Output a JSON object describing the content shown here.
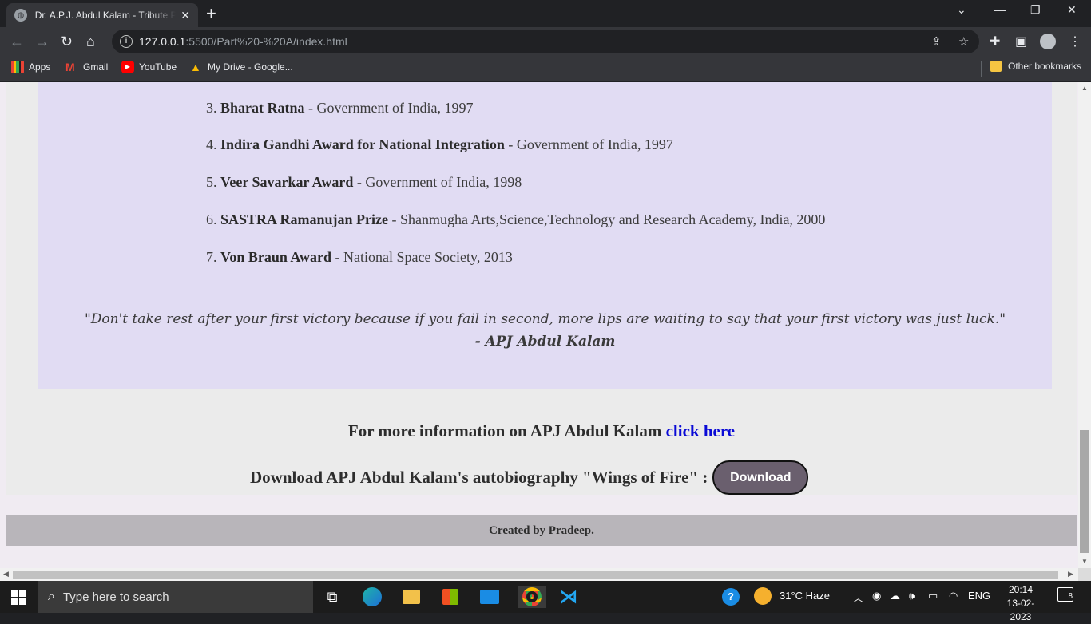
{
  "browser": {
    "tab_title": "Dr. A.P.J. Abdul Kalam - Tribute Page",
    "url_host": "127.0.0.1",
    "url_rest": ":5500/Part%20-%20A/index.html",
    "bookmarks": [
      "Apps",
      "Gmail",
      "YouTube",
      "My Drive - Google..."
    ],
    "other_bookmarks": "Other bookmarks"
  },
  "awards": [
    {
      "num": "3.",
      "name": "Bharat Ratna",
      "detail": " - Government of India, 1997"
    },
    {
      "num": "4.",
      "name": "Indira Gandhi Award for National Integration",
      "detail": " - Government of India, 1997"
    },
    {
      "num": "5.",
      "name": "Veer Savarkar Award",
      "detail": " - Government of India, 1998"
    },
    {
      "num": "6.",
      "name": "SASTRA Ramanujan Prize",
      "detail": " - Shanmugha Arts,Science,Technology and Research Academy, India, 2000"
    },
    {
      "num": "7.",
      "name": "Von Braun Award",
      "detail": " - National Space Society, 2013"
    }
  ],
  "quote": {
    "text": "\"Don't take rest after your first victory because if you fail in second, more lips are waiting to say that your first victory was just luck.\"",
    "author": "- APJ Abdul Kalam"
  },
  "more_info": {
    "text": "For more information on APJ Abdul Kalam ",
    "link": "click here"
  },
  "download": {
    "text": "Download APJ Abdul Kalam's autobiography \"Wings of Fire\" :",
    "button": "Download"
  },
  "footer": "Created by Pradeep.",
  "taskbar": {
    "search_placeholder": "Type here to search",
    "weather": "31°C  Haze",
    "lang": "ENG",
    "time": "20:14",
    "date": "13-02-2023",
    "notifications": "8"
  }
}
